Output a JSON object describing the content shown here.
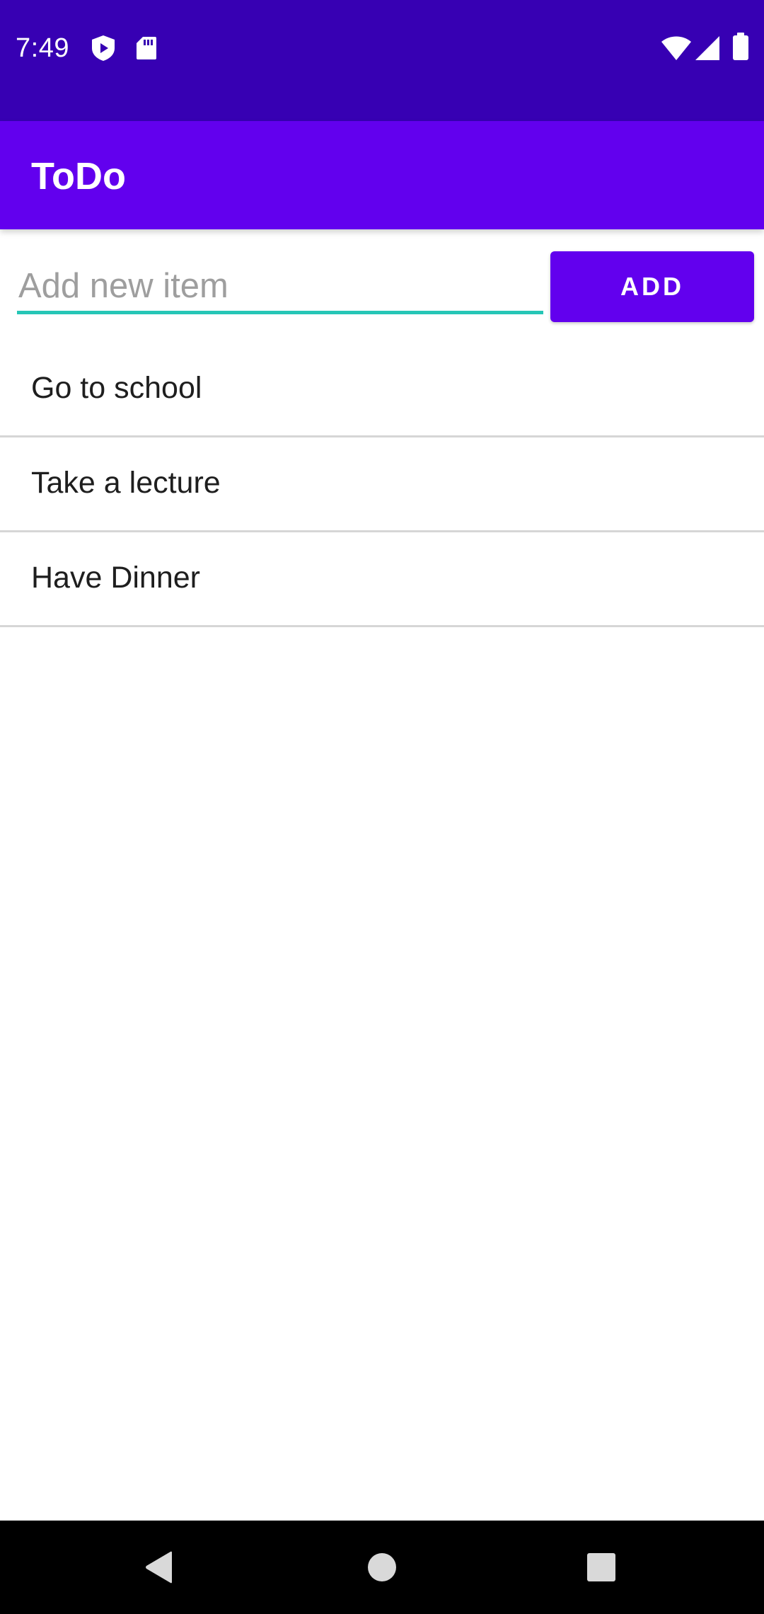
{
  "status_bar": {
    "time": "7:49",
    "left_icons": [
      "play-protect-icon",
      "sd-card-icon"
    ],
    "right_icons": [
      "wifi-icon",
      "cell-signal-icon",
      "battery-icon"
    ]
  },
  "app_bar": {
    "title": "ToDo"
  },
  "input": {
    "placeholder": "Add new item",
    "value": ""
  },
  "add_button": {
    "label": "ADD"
  },
  "items": [
    {
      "label": "Go to school"
    },
    {
      "label": "Take a lecture"
    },
    {
      "label": "Have Dinner"
    }
  ],
  "nav_bar": {
    "buttons": [
      "back-icon",
      "home-icon",
      "recents-icon"
    ]
  },
  "colors": {
    "status_bar": "#3700b3",
    "primary": "#6200ee",
    "input_underline": "#26c6b6",
    "divider": "#d6d6d6",
    "nav_bar": "#000000"
  }
}
